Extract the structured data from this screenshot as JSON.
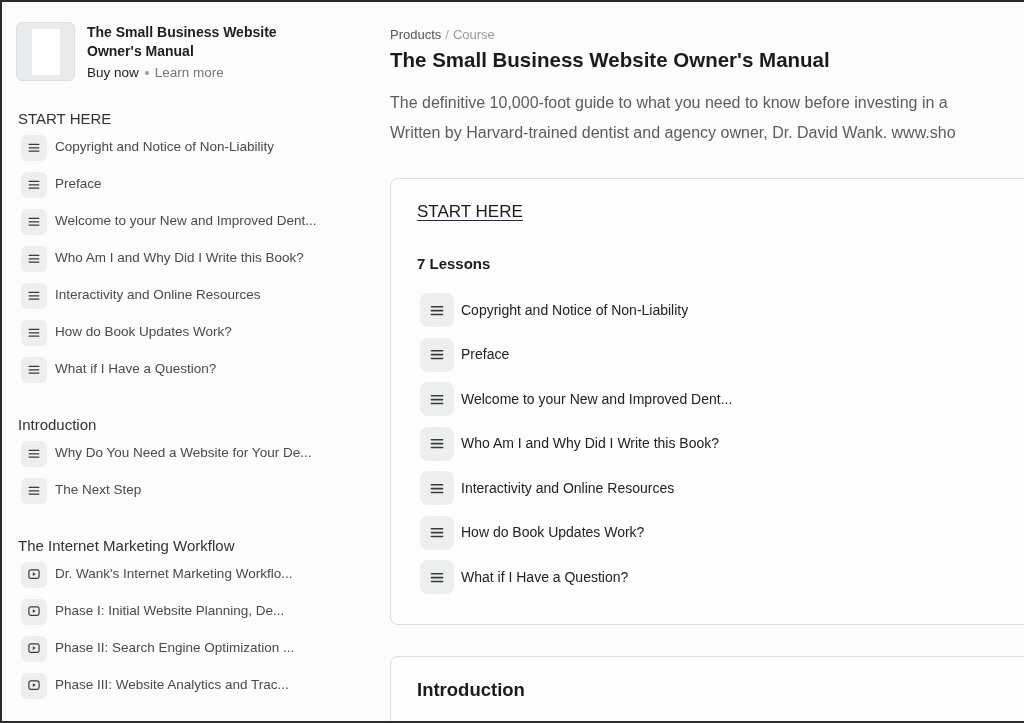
{
  "product": {
    "title": "The Small Business Website Owner's Manual",
    "links": [
      "Buy now",
      "Learn more"
    ]
  },
  "sidebar": {
    "sections": [
      {
        "title": "START HERE",
        "items": [
          {
            "title": "Copyright and Notice of Non-Liability",
            "kind": "text"
          },
          {
            "title": "Preface",
            "kind": "text"
          },
          {
            "title": "Welcome to your New and Improved Dent...",
            "kind": "text"
          },
          {
            "title": "Who Am I and Why Did I Write this Book?",
            "kind": "text"
          },
          {
            "title": "Interactivity and Online Resources",
            "kind": "text"
          },
          {
            "title": "How do Book Updates Work?",
            "kind": "text"
          },
          {
            "title": "What if I Have a Question?",
            "kind": "text"
          }
        ]
      },
      {
        "title": "Introduction",
        "items": [
          {
            "title": "Why Do You Need a Website for Your De...",
            "kind": "text"
          },
          {
            "title": "The Next Step",
            "kind": "text"
          }
        ]
      },
      {
        "title": "The Internet Marketing Workflow",
        "items": [
          {
            "title": "Dr. Wank's Internet Marketing Workflo...",
            "kind": "video"
          },
          {
            "title": "Phase I: Initial Website Planning, De...",
            "kind": "video"
          },
          {
            "title": "Phase II: Search Engine Optimization ...",
            "kind": "video"
          },
          {
            "title": "Phase III: Website Analytics and Trac...",
            "kind": "video"
          }
        ]
      }
    ]
  },
  "breadcrumb": {
    "items": [
      "Products",
      "Course"
    ],
    "separator": "/"
  },
  "page_title": "The Small Business Website Owner's Manual",
  "description": [
    "The definitive 10,000-foot guide to what you need to know before investing in a",
    "Written by Harvard-trained dentist and agency owner, Dr. David Wank. www.sho"
  ],
  "sections": [
    {
      "title": "START HERE",
      "underlined": true,
      "lesson_count": "7 Lessons",
      "lessons": [
        {
          "title": "Copyright and Notice of Non-Liability",
          "kind": "text"
        },
        {
          "title": "Preface",
          "kind": "text"
        },
        {
          "title": "Welcome to your New and Improved Dent...",
          "kind": "text"
        },
        {
          "title": "Who Am I and Why Did I Write this Book?",
          "kind": "text"
        },
        {
          "title": "Interactivity and Online Resources",
          "kind": "text"
        },
        {
          "title": "How do Book Updates Work?",
          "kind": "text"
        },
        {
          "title": "What if I Have a Question?",
          "kind": "text"
        }
      ]
    },
    {
      "title": "Introduction",
      "underlined": false
    }
  ]
}
